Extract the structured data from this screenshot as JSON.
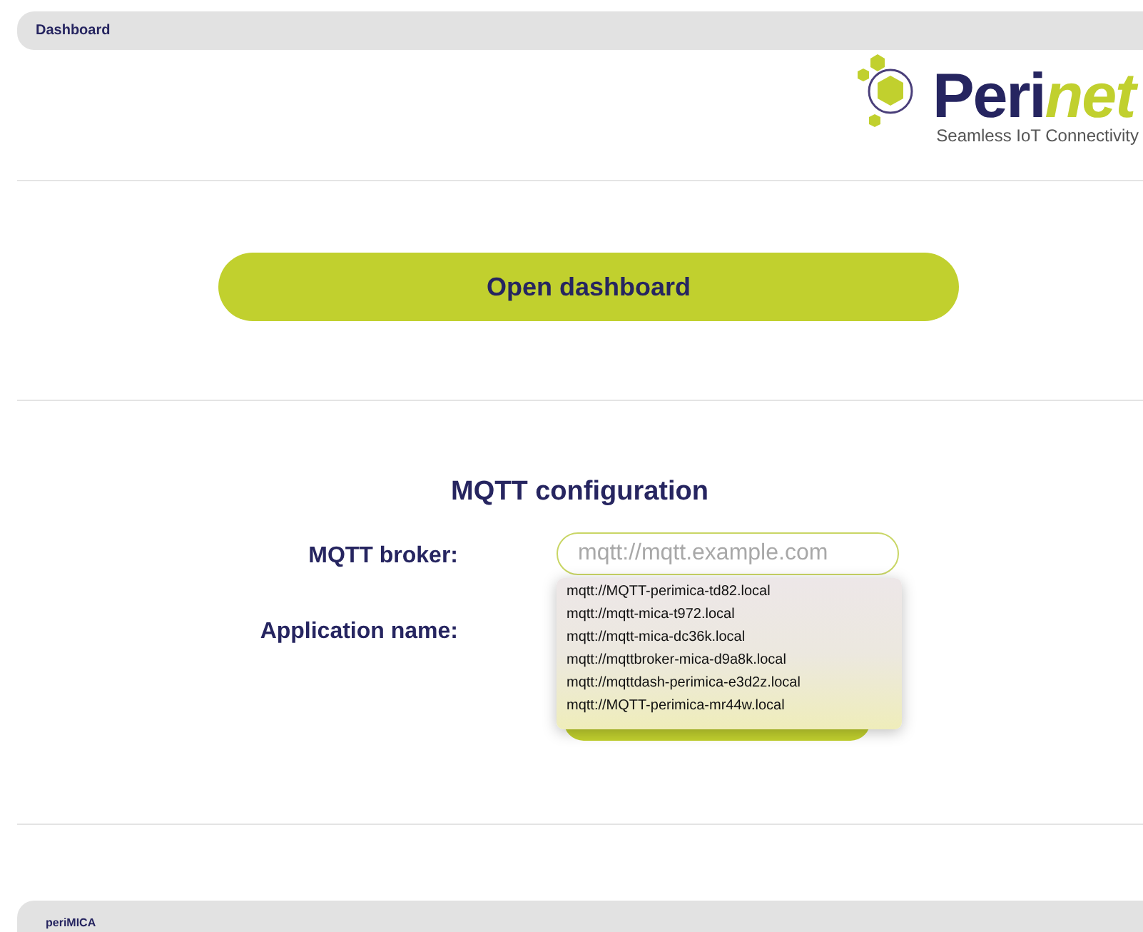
{
  "header": {
    "title": "Dashboard"
  },
  "logo": {
    "brand_main": "Peri",
    "brand_accent": "net",
    "tagline": "Seamless IoT Connectivity"
  },
  "open_button": {
    "label": "Open dashboard"
  },
  "mqtt": {
    "heading": "MQTT configuration",
    "broker": {
      "label": "MQTT broker:",
      "placeholder": "mqtt://mqtt.example.com"
    },
    "app_name": {
      "label": "Application name:"
    },
    "suggestions": [
      "mqtt://MQTT-perimica-td82.local",
      "mqtt://mqtt-mica-t972.local",
      "mqtt://mqtt-mica-dc36k.local",
      "mqtt://mqttbroker-mica-d9a8k.local",
      "mqtt://mqttdash-perimica-e3d2z.local",
      "mqtt://MQTT-perimica-mr44w.local"
    ]
  },
  "footer": {
    "title": "periMICA"
  }
}
